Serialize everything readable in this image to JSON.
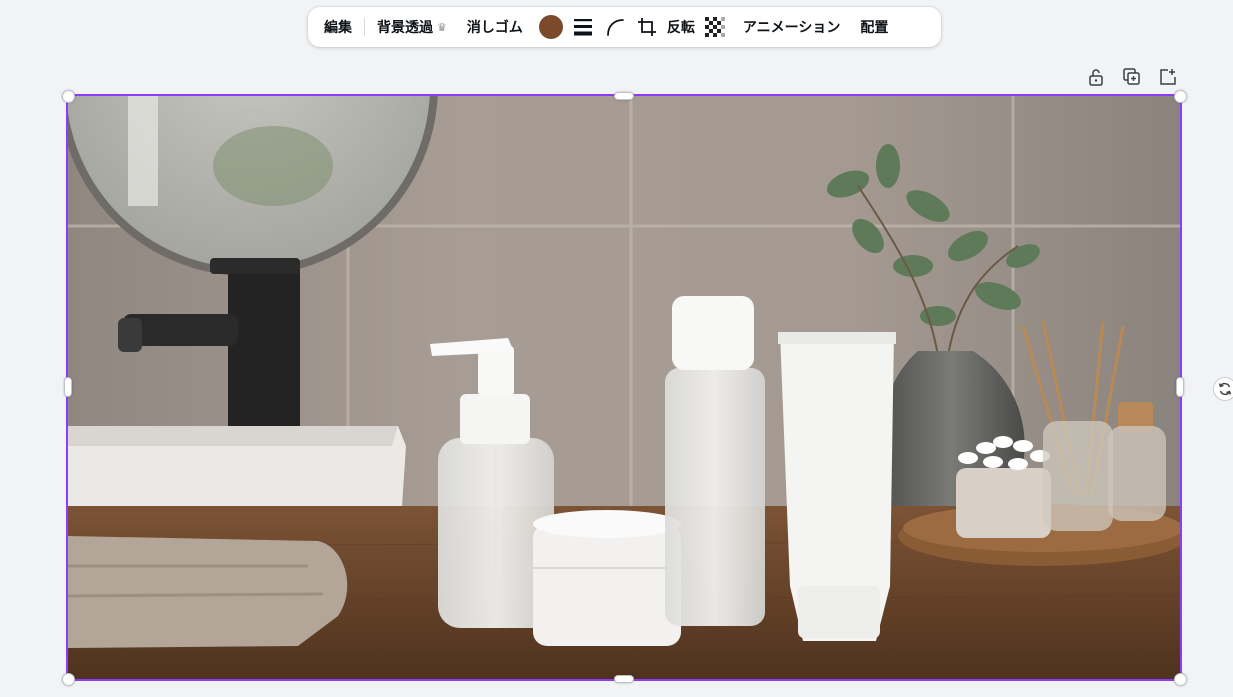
{
  "toolbar": {
    "edit_label": "編集",
    "bg_remove_label": "背景透過",
    "eraser_label": "消しゴム",
    "flip_label": "反転",
    "animation_label": "アニメーション",
    "position_label": "配置",
    "swatch_color": "#7a4a2a",
    "premium_icon": "crown-icon",
    "icons": [
      "border-style-icon",
      "corner-rounding-icon",
      "crop-icon",
      "transparency-icon"
    ]
  },
  "element_actions": {
    "icons": [
      "lock-icon",
      "duplicate-icon",
      "add-page-icon"
    ]
  },
  "selection": {
    "accent_color": "#8b3dff",
    "rotate_icon": "rotate-icon"
  },
  "canvas_image": {
    "subject": "bathroom-counter-with-skincare-bottles"
  }
}
